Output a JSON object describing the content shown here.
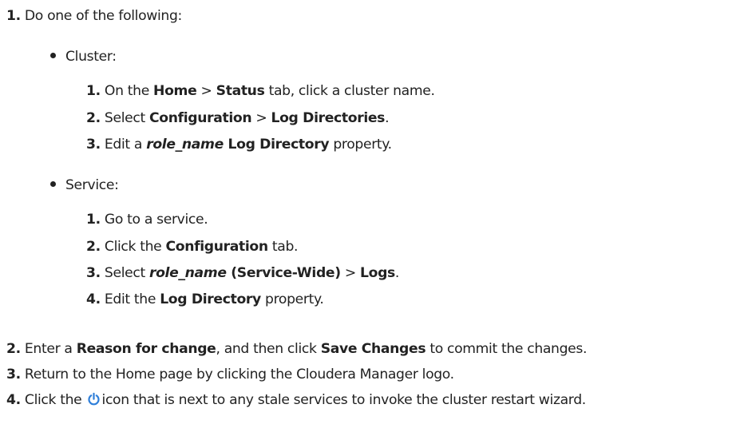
{
  "steps": {
    "s1": {
      "num": "1.",
      "text": "Do one of the following:",
      "cluster": {
        "label": "Cluster:",
        "sub": [
          {
            "num": "1.",
            "p1": "On the ",
            "b1": "Home",
            "p2": " > ",
            "b2": "Status",
            "p3": " tab, click a cluster name."
          },
          {
            "num": "2.",
            "p1": "Select ",
            "b1": "Configuration",
            "p2": " > ",
            "b2": "Log Directories",
            "p3": "."
          },
          {
            "num": "3.",
            "p1": "Edit a ",
            "bi": "role_name",
            "b1": " Log Directory",
            "p2": " property."
          }
        ]
      },
      "service": {
        "label": "Service:",
        "sub": [
          {
            "num": "1.",
            "p1": "Go to a service."
          },
          {
            "num": "2.",
            "p1": "Click the ",
            "b1": "Configuration",
            "p2": " tab."
          },
          {
            "num": "3.",
            "p1": "Select ",
            "bi": "role_name",
            "b1": " (Service-Wide)",
            "p2": " > ",
            "b2": "Logs",
            "p3": "."
          },
          {
            "num": "4.",
            "p1": "Edit the ",
            "b1": "Log Directory",
            "p2": " property."
          }
        ]
      }
    },
    "s2": {
      "num": "2.",
      "p1": "Enter a ",
      "b1": "Reason for change",
      "p2": ", and then click ",
      "b2": "Save Changes",
      "p3": " to commit the changes."
    },
    "s3": {
      "num": "3.",
      "p1": "Return to the Home page by clicking the Cloudera Manager logo."
    },
    "s4": {
      "num": "4.",
      "p1": "Click the ",
      "p2": "icon that is next to any stale services to invoke the cluster restart wizard.",
      "icon": "power-icon",
      "icon_color": "#2f7fd9"
    }
  }
}
